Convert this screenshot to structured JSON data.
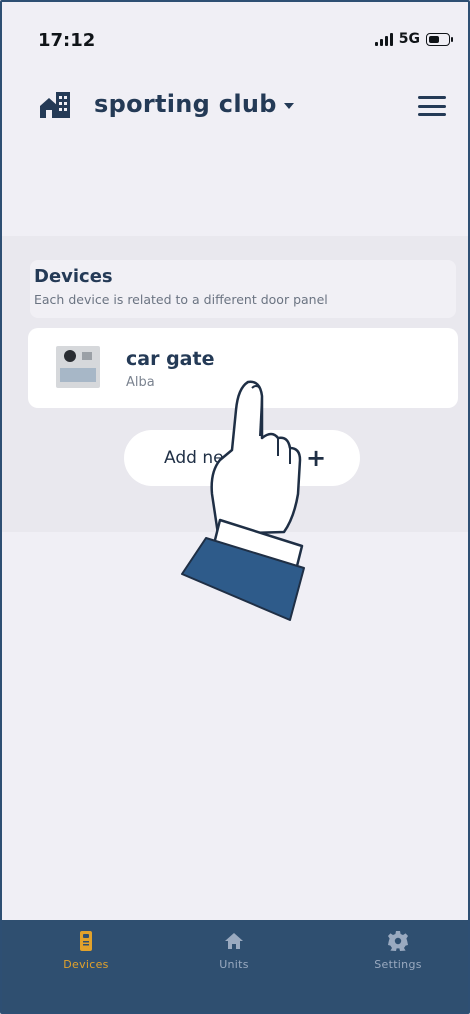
{
  "status_bar": {
    "time": "17:12",
    "network": "5G"
  },
  "header": {
    "club_name": "sporting club"
  },
  "devices_section": {
    "title": "Devices",
    "subtitle": "Each device is related to a different door panel"
  },
  "devices": [
    {
      "name": "car gate",
      "model": "Alba"
    }
  ],
  "add_button": {
    "label": "Add ne",
    "plus": "+"
  },
  "tabs": [
    {
      "label": "Devices",
      "active": true
    },
    {
      "label": "Units",
      "active": false
    },
    {
      "label": "Settings",
      "active": false
    }
  ],
  "colors": {
    "accent": "#e2a22b",
    "primary": "#243a56",
    "tabbar": "#2f4f70"
  }
}
